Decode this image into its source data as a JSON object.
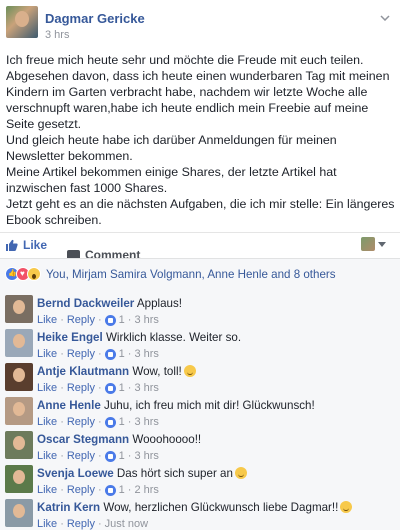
{
  "post": {
    "author": "Dagmar Gericke",
    "time": "3 hrs",
    "options_icon": "chevron-down-icon",
    "paragraphs": [
      "Ich freue mich heute sehr und möchte die Freude mit euch teilen. Abgesehen davon, dass ich heute einen wunderbaren Tag mit meinen Kindern im Garten verbracht habe, nachdem wir letzte Woche alle verschnupft waren,habe ich heute endlich mein Freebie auf meine Seite gesetzt.",
      "Und gleich heute habe ich darüber Anmeldungen für meinen Newsletter bekommen.",
      "Meine Artikel bekommen einige Shares, der letzte Artikel hat inzwischen fast 1000 Shares.",
      "Jetzt geht es an die nächsten Aufgaben, die ich mir stelle: Ein längeres Ebook schreiben."
    ]
  },
  "actions": {
    "like_label": "Like",
    "comment_label": "Comment"
  },
  "reactions": {
    "icons": [
      "like-reaction-icon",
      "love-reaction-icon",
      "wow-reaction-icon"
    ],
    "summary": "You, Mirjam Samira Volgmann, Anne Henle and 8 others"
  },
  "comments": [
    {
      "name": "Bernd Dackweiler",
      "text": "Applaus!",
      "emoji": false,
      "like_label": "Like",
      "reply_label": "Reply",
      "likes": "1",
      "time": "3 hrs",
      "avatar_color": "#7a6e62"
    },
    {
      "name": "Heike Engel",
      "text": "Wirklich klasse. Weiter so.",
      "emoji": false,
      "like_label": "Like",
      "reply_label": "Reply",
      "likes": "1",
      "time": "3 hrs",
      "avatar_color": "#9aa8b8"
    },
    {
      "name": "Antje Klautmann",
      "text": "Wow, toll!",
      "emoji": true,
      "like_label": "Like",
      "reply_label": "Reply",
      "likes": "1",
      "time": "3 hrs",
      "avatar_color": "#5a3e2e"
    },
    {
      "name": "Anne Henle",
      "text": "Juhu, ich freu mich mit dir! Glückwunsch!",
      "emoji": false,
      "like_label": "Like",
      "reply_label": "Reply",
      "likes": "1",
      "time": "3 hrs",
      "avatar_color": "#b59a84"
    },
    {
      "name": "Oscar Stegmann",
      "text": "Wooohoooo!!",
      "emoji": false,
      "like_label": "Like",
      "reply_label": "Reply",
      "likes": "1",
      "time": "3 hrs",
      "avatar_color": "#6d7b5c"
    },
    {
      "name": "Svenja Loewe",
      "text": "Das hört sich super an",
      "emoji": true,
      "like_label": "Like",
      "reply_label": "Reply",
      "likes": "1",
      "time": "2 hrs",
      "avatar_color": "#5b7a4a"
    },
    {
      "name": "Katrin Kern",
      "text": "Wow, herzlichen Glückwunsch liebe Dagmar!!",
      "emoji": true,
      "like_label": "Like",
      "reply_label": "Reply",
      "likes": "",
      "time": "Just now",
      "avatar_color": "#8a9aa6"
    }
  ],
  "colors": {
    "link": "#365899",
    "meta": "#90949c",
    "accent": "#4267b2",
    "comments_bg": "#f6f7f9"
  }
}
